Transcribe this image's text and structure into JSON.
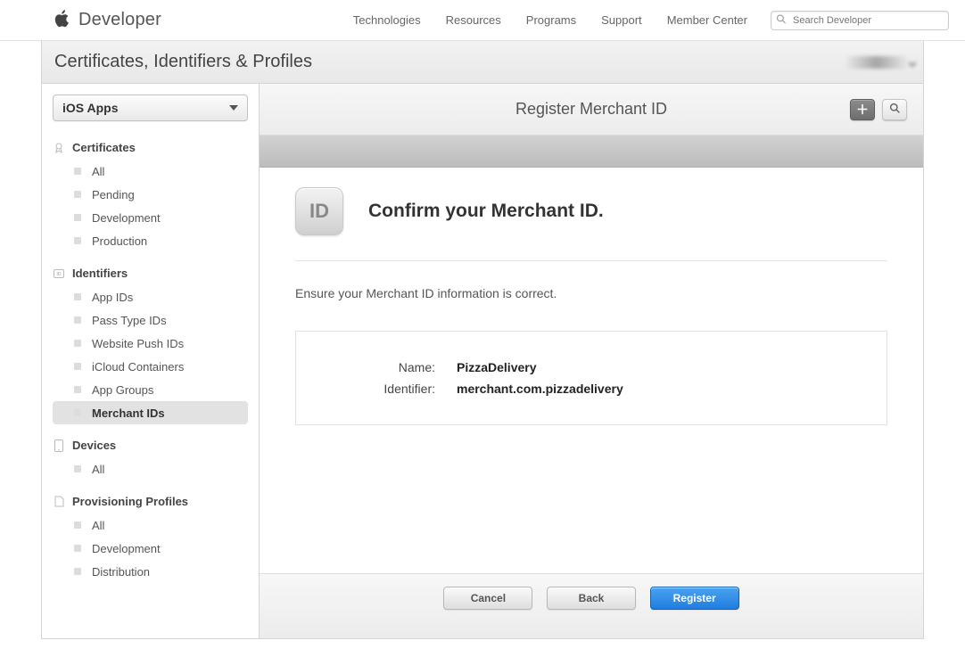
{
  "topnav": {
    "title": "Developer",
    "items": [
      "Technologies",
      "Resources",
      "Programs",
      "Support",
      "Member Center"
    ],
    "search_placeholder": "Search Developer"
  },
  "subheader": {
    "title": "Certificates, Identifiers & Profiles"
  },
  "sidebar": {
    "platform": "iOS Apps",
    "sections": [
      {
        "title": "Certificates",
        "icon": "badge",
        "items": [
          "All",
          "Pending",
          "Development",
          "Production"
        ]
      },
      {
        "title": "Identifiers",
        "icon": "id",
        "items": [
          "App IDs",
          "Pass Type IDs",
          "Website Push IDs",
          "iCloud Containers",
          "App Groups",
          "Merchant IDs"
        ],
        "active": "Merchant IDs"
      },
      {
        "title": "Devices",
        "icon": "device",
        "items": [
          "All"
        ]
      },
      {
        "title": "Provisioning Profiles",
        "icon": "profile",
        "items": [
          "All",
          "Development",
          "Distribution"
        ]
      }
    ]
  },
  "main": {
    "title": "Register Merchant ID",
    "id_tile_label": "ID",
    "heading": "Confirm your Merchant ID.",
    "instruction": "Ensure your Merchant ID information is correct.",
    "fields": {
      "name_label": "Name:",
      "name_value": "PizzaDelivery",
      "identifier_label": "Identifier:",
      "identifier_value": "merchant.com.pizzadelivery"
    },
    "buttons": {
      "cancel": "Cancel",
      "back": "Back",
      "register": "Register"
    }
  }
}
